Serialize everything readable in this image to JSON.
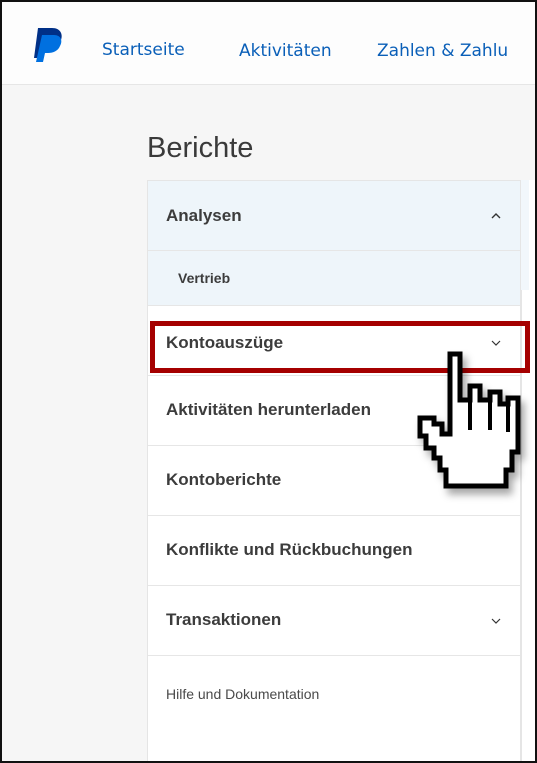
{
  "nav": {
    "links": [
      {
        "label": "Startseite"
      },
      {
        "label": "Aktivitäten"
      },
      {
        "label": "Zahlen & Zahlu"
      }
    ],
    "brand_color": "#003087",
    "link_color": "#0a5fb8"
  },
  "page": {
    "title": "Berichte"
  },
  "sidebar": {
    "items": [
      {
        "label": "Analysen",
        "expanded": true,
        "icon": "chevron-up-icon"
      },
      {
        "label": "Vertrieb",
        "sub_item": true
      },
      {
        "label": "Kontoauszüge",
        "expanded": false,
        "icon": "chevron-down-icon",
        "highlighted": true
      },
      {
        "label": "Aktivitäten herunterladen"
      },
      {
        "label": "Kontoberichte"
      },
      {
        "label": "Konflikte und Rückbuchungen"
      },
      {
        "label": "Transaktionen",
        "expanded": false,
        "icon": "chevron-down-icon"
      },
      {
        "label": "Hilfe und Dokumentation"
      }
    ],
    "selected_bg": "#eef5fa"
  },
  "annotation": {
    "highlight_color": "#a50000",
    "pointer_icon": "hand-pointer-icon"
  }
}
